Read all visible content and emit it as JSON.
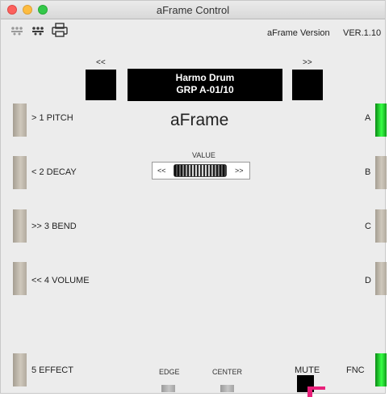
{
  "window": {
    "title": "aFrame Control"
  },
  "toolbar": {
    "icons": [
      "midi-in-icon",
      "midi-out-icon",
      "printer-icon"
    ],
    "version_label": "aFrame Version",
    "version_value": "VER.1.10"
  },
  "nav": {
    "prev_label": "<<",
    "next_label": ">>"
  },
  "display": {
    "line1": "Harmo Drum",
    "line2": "GRP A-01/10"
  },
  "app_name": "aFrame",
  "knobs": [
    {
      "label": "> 1 PITCH"
    },
    {
      "label": "< 2 DECAY"
    },
    {
      "label": ">> 3 BEND"
    },
    {
      "label": "<< 4 VOLUME"
    },
    {
      "label": "5 EFFECT"
    }
  ],
  "pads": [
    {
      "label": "A",
      "active": true
    },
    {
      "label": "B",
      "active": false
    },
    {
      "label": "C",
      "active": false
    },
    {
      "label": "D",
      "active": false
    },
    {
      "label": "FNC",
      "active": true
    }
  ],
  "value_control": {
    "label": "VALUE",
    "dec": "<<",
    "inc": ">>"
  },
  "bottom": {
    "edge_label": "EDGE",
    "center_label": "CENTER",
    "mute_label": "MUTE"
  },
  "colors": {
    "active_green": "#38ff46",
    "display_bg": "#000000",
    "cursor_pink": "#e8207a"
  }
}
